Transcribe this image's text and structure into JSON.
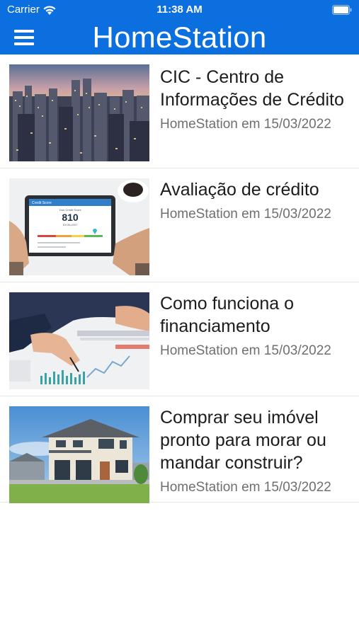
{
  "status_bar": {
    "carrier": "Carrier",
    "time": "11:38 AM",
    "wifi_icon": "wifi-icon",
    "battery_icon": "battery-icon"
  },
  "nav_bar": {
    "title": "HomeStation",
    "menu_icon": "hamburger-menu-icon",
    "background_color": "#0b6fe0"
  },
  "articles": [
    {
      "title": "CIC - Centro de Informações de Crédito",
      "meta": "HomeStation em 15/03/2022",
      "thumbnail": "city-skyline-image"
    },
    {
      "title": "Avaliação de crédito",
      "meta": "HomeStation em 15/03/2022",
      "thumbnail": "credit-score-tablet-image",
      "thumbnail_text": {
        "header": "Credit Score",
        "label": "Your Credit Score",
        "score": "810",
        "rating": "EXCELLENT"
      }
    },
    {
      "title": "Como funciona o financiamento",
      "meta": "HomeStation em 15/03/2022",
      "thumbnail": "financial-charts-image"
    },
    {
      "title": "Comprar seu imóvel pronto para morar ou mandar construir?",
      "meta": "HomeStation em 15/03/2022",
      "thumbnail": "house-image"
    }
  ]
}
